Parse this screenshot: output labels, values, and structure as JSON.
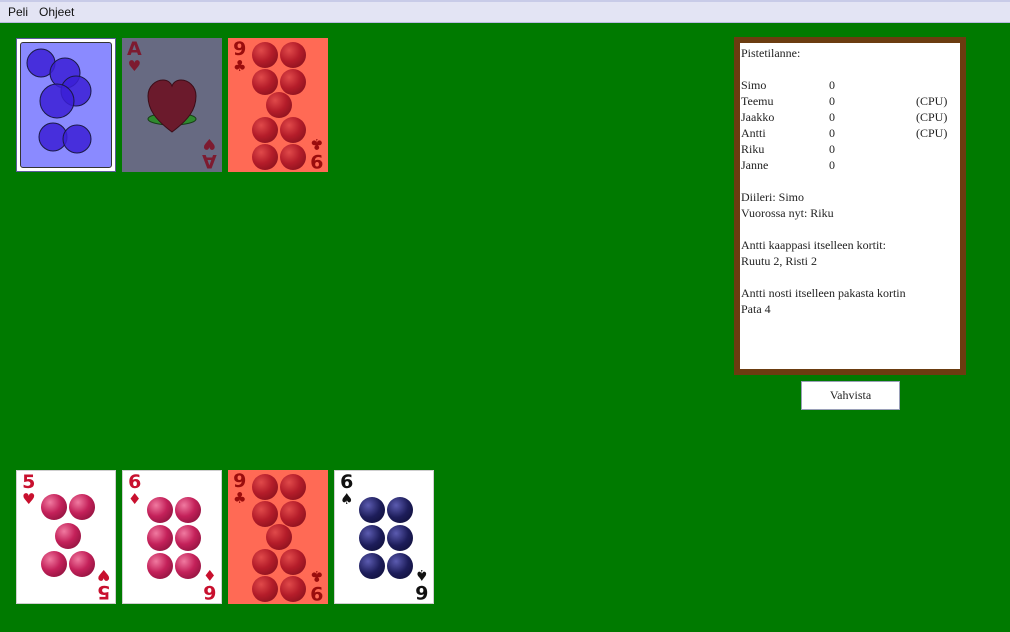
{
  "menu": {
    "game_label": "Peli",
    "help_label": "Ohjeet"
  },
  "colors": {
    "table": "#007a00",
    "board_frame": "#6b3c10",
    "card_back": "#8a8aff",
    "card_salmon": "#ff6a55",
    "card_grey": "#676a82"
  },
  "table_cards": [
    {
      "kind": "back"
    },
    {
      "rank": "A",
      "suit": "hearts",
      "suit_symbol": "♥"
    },
    {
      "rank": "9",
      "suit": "clubs",
      "suit_symbol": "♣"
    }
  ],
  "hand": [
    {
      "rank": "5",
      "suit": "hearts",
      "suit_symbol": "♥"
    },
    {
      "rank": "6",
      "suit": "diamonds",
      "suit_symbol": "♦"
    },
    {
      "rank": "9",
      "suit": "clubs",
      "suit_symbol": "♣"
    },
    {
      "rank": "6",
      "suit": "spades",
      "suit_symbol": "♠"
    }
  ],
  "scoreboard": {
    "heading": "Pistetilanne:",
    "players": [
      {
        "name": "Simo",
        "score": "0",
        "tag": ""
      },
      {
        "name": "Teemu",
        "score": "0",
        "tag": "(CPU)"
      },
      {
        "name": "Jaakko",
        "score": "0",
        "tag": "(CPU)"
      },
      {
        "name": "Antti",
        "score": "0",
        "tag": "(CPU)"
      },
      {
        "name": "Riku",
        "score": "0",
        "tag": ""
      },
      {
        "name": "Janne",
        "score": "0",
        "tag": ""
      }
    ],
    "dealer_line": "Diileri: Simo",
    "turn_line": "Vuorossa nyt: Riku",
    "log1_line1": "Antti kaappasi itselleen kortit:",
    "log1_line2": "Ruutu 2, Risti 2",
    "log2_line1": "Antti nosti itselleen pakasta kortin",
    "log2_line2": "Pata 4"
  },
  "confirm_label": "Vahvista"
}
